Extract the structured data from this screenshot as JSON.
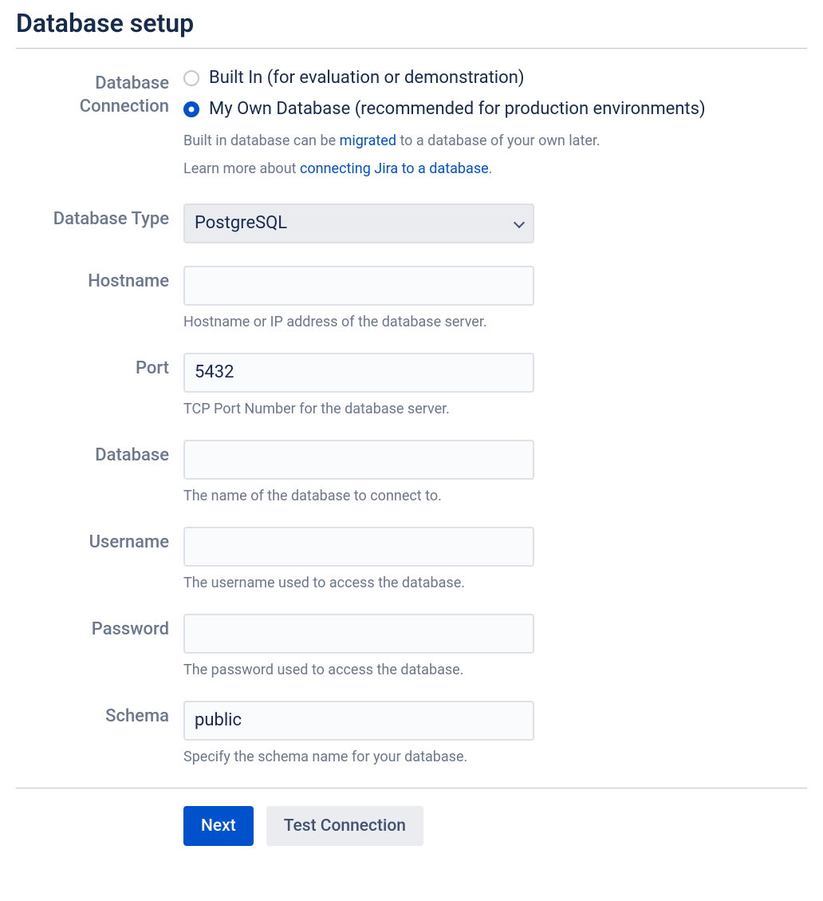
{
  "title": "Database setup",
  "connection": {
    "label": "Database Connection",
    "options": [
      {
        "label": "Built In (for evaluation or demonstration)",
        "selected": false
      },
      {
        "label": "My Own Database (recommended for production environments)",
        "selected": true
      }
    ],
    "help1_pre": "Built in database can be ",
    "help1_link": "migrated",
    "help1_post": " to a database of your own later.",
    "help2_pre": "Learn more about ",
    "help2_link": "connecting Jira to a database",
    "help2_post": "."
  },
  "dbtype": {
    "label": "Database Type",
    "value": "PostgreSQL"
  },
  "hostname": {
    "label": "Hostname",
    "value": "",
    "desc": "Hostname or IP address of the database server."
  },
  "port": {
    "label": "Port",
    "value": "5432",
    "desc": "TCP Port Number for the database server."
  },
  "database": {
    "label": "Database",
    "value": "",
    "desc": "The name of the database to connect to."
  },
  "username": {
    "label": "Username",
    "value": "",
    "desc": "The username used to access the database."
  },
  "password": {
    "label": "Password",
    "value": "",
    "desc": "The password used to access the database."
  },
  "schema": {
    "label": "Schema",
    "value": "public",
    "desc": "Specify the schema name for your database."
  },
  "actions": {
    "next": "Next",
    "test": "Test Connection"
  }
}
